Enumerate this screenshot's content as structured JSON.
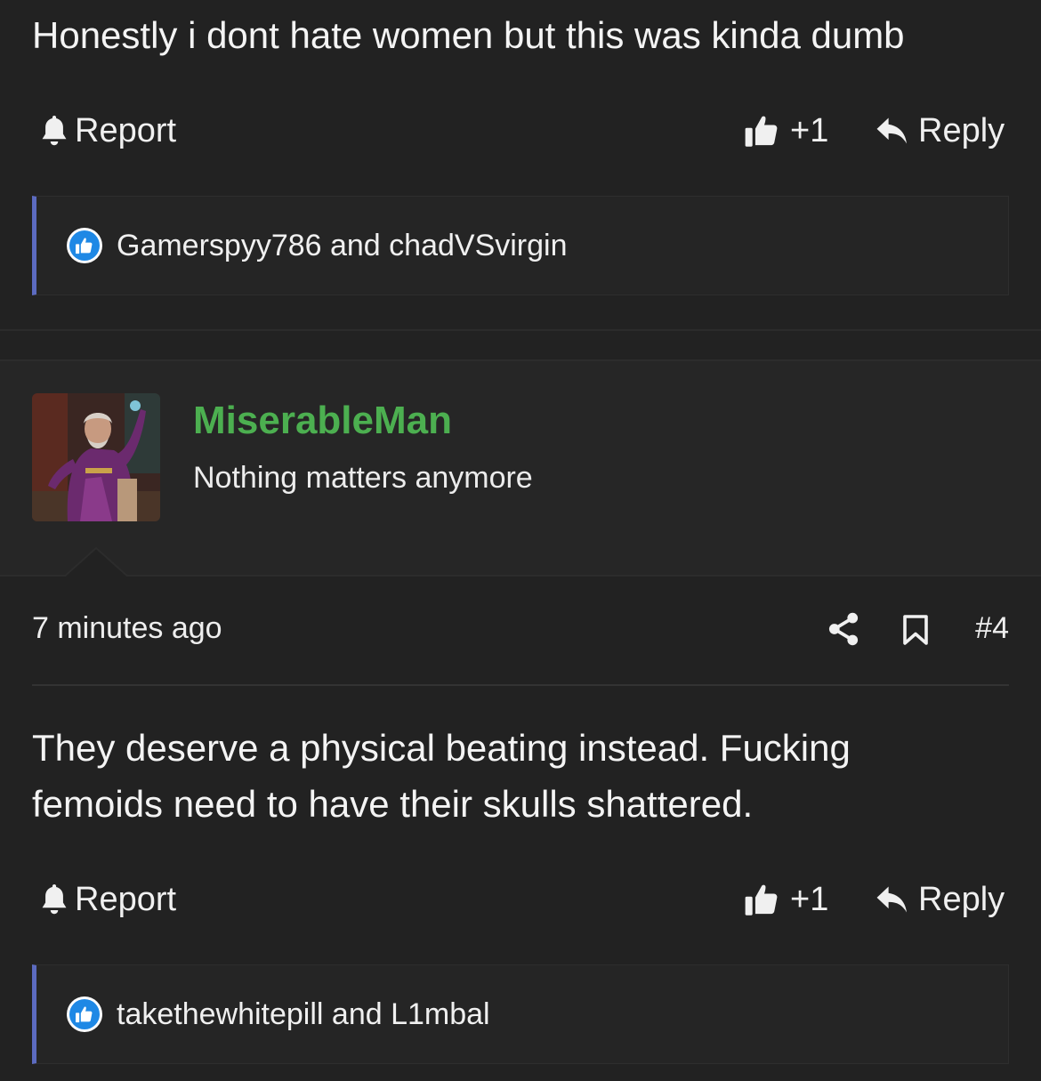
{
  "prev_post": {
    "body": "Honestly i dont hate women but this was kinda dumb",
    "report_label": "Report",
    "like_count": "+1",
    "reply_label": "Reply",
    "reactions_text": "Gamerspyy786 and chadVSvirgin"
  },
  "post": {
    "username": "MiserableMan",
    "user_title": "Nothing matters anymore",
    "timestamp": "7 minutes ago",
    "post_number": "#4",
    "body_line1": "They deserve a physical beating instead. Fucking",
    "body_line2": "femoids need to have their skulls shattered.",
    "report_label": "Report",
    "like_count": "+1",
    "reply_label": "Reply",
    "reactions_text": "takethewhitepill and L1mbal"
  },
  "colors": {
    "background": "#222222",
    "username": "#4caf50",
    "reaction_accent": "#5c6bc0",
    "like_badge": "#1e88e5"
  },
  "icons": [
    "bell-icon",
    "thumbs-up-icon",
    "reply-arrow-icon",
    "share-icon",
    "bookmark-icon",
    "like-reaction-icon"
  ]
}
